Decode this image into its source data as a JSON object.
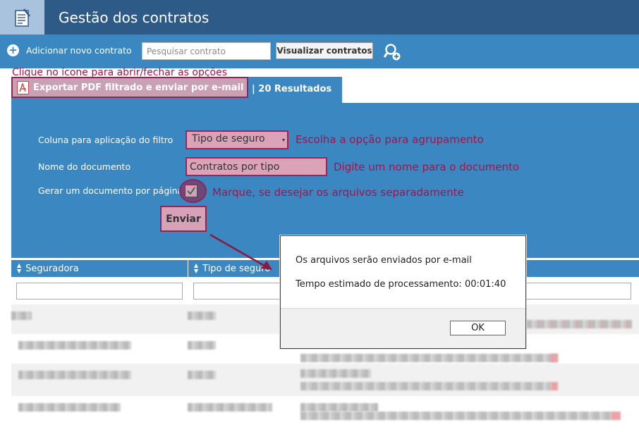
{
  "app": {
    "title": "Gestão dos contratos",
    "logo_icon": "notepad-icon"
  },
  "toolbar": {
    "add_label": "Adicionar novo contrato",
    "search_placeholder": "Pesquisar contrato",
    "view_label": "Visualizar contratos",
    "user_search_icon": "user-search-icon"
  },
  "hints": {
    "top": "Clique no ícone para abrir/fechar as opções",
    "group": "Escolha a opção para agrupamento",
    "name": "Digite um nome para o documento",
    "separate": "Marque, se desejar os arquivos separadamente"
  },
  "tabs": {
    "pdf_label": "Exportar PDF filtrado e enviar por e-mail",
    "results": "| 20 Resultados"
  },
  "form": {
    "column_label": "Coluna para aplicação do filtro",
    "column_value": "Tipo de seguro",
    "docname_label": "Nome do documento",
    "docname_value": "Contratos por tipo",
    "per_page_label": "Gerar um documento por página",
    "per_page_checked": true,
    "send_label": "Enviar"
  },
  "grid": {
    "columns": [
      "Seguradora",
      "Tipo de seguro"
    ]
  },
  "dialog": {
    "line1": "Os arquivos serão enviados por e-mail",
    "line2": "Tempo estimado de processamento: 00:01:40",
    "ok_label": "OK"
  },
  "colors": {
    "header": "#2e5a87",
    "toolbar": "#3a87c2",
    "annotation": "#a0154a"
  }
}
